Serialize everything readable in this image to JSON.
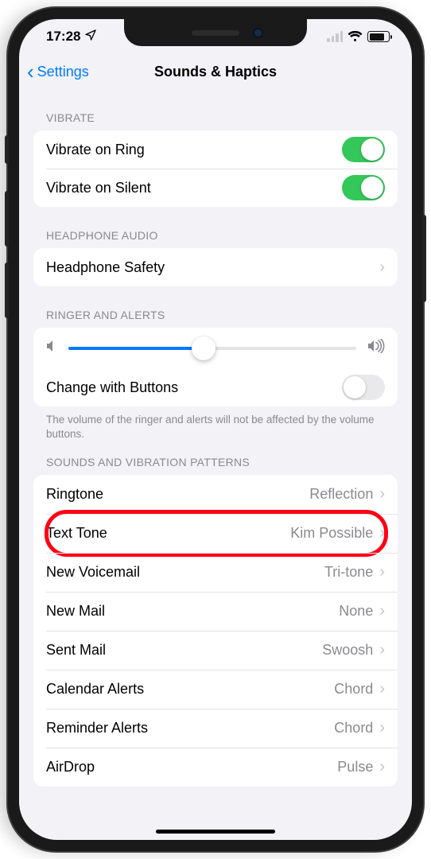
{
  "status": {
    "time": "17:28"
  },
  "nav": {
    "back": "Settings",
    "title": "Sounds & Haptics"
  },
  "sections": {
    "vibrate": {
      "header": "VIBRATE",
      "ring": "Vibrate on Ring",
      "silent": "Vibrate on Silent"
    },
    "headphone": {
      "header": "HEADPHONE AUDIO",
      "safety": "Headphone Safety"
    },
    "ringer": {
      "header": "RINGER AND ALERTS",
      "change_buttons": "Change with Buttons",
      "footnote": "The volume of the ringer and alerts will not be affected by the volume buttons.",
      "slider_value_pct": 47
    },
    "sounds": {
      "header": "SOUNDS AND VIBRATION PATTERNS",
      "items": [
        {
          "label": "Ringtone",
          "value": "Reflection"
        },
        {
          "label": "Text Tone",
          "value": "Kim Possible"
        },
        {
          "label": "New Voicemail",
          "value": "Tri-tone"
        },
        {
          "label": "New Mail",
          "value": "None"
        },
        {
          "label": "Sent Mail",
          "value": "Swoosh"
        },
        {
          "label": "Calendar Alerts",
          "value": "Chord"
        },
        {
          "label": "Reminder Alerts",
          "value": "Chord"
        },
        {
          "label": "AirDrop",
          "value": "Pulse"
        }
      ]
    }
  }
}
